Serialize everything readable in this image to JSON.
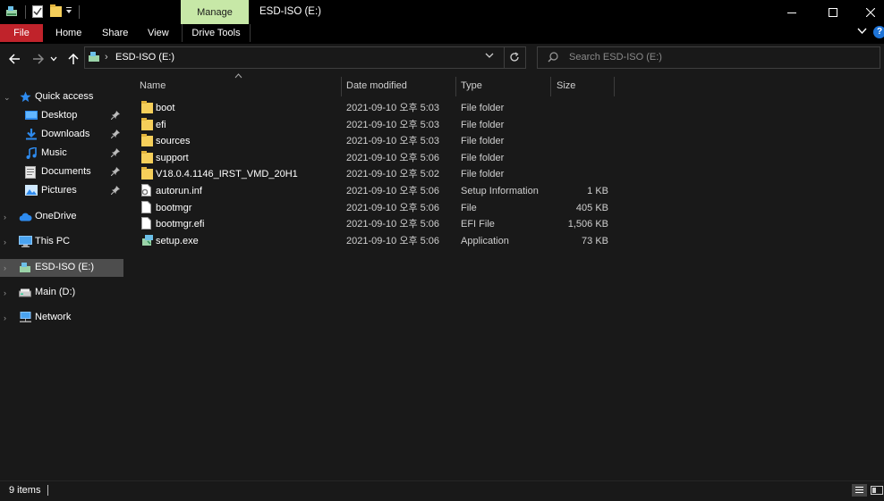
{
  "window": {
    "title": "ESD-ISO (E:)",
    "manage_tab": "Manage",
    "controls": {
      "minimize": "minimize-icon",
      "maximize": "maximize-icon",
      "close": "close-icon"
    }
  },
  "ribbon": {
    "tabs": [
      "File",
      "Home",
      "Share",
      "View",
      "Drive Tools"
    ],
    "file_color": "#c0232b",
    "manage_color": "#c7e8a7"
  },
  "address": {
    "path": "ESD-ISO (E:)",
    "search_placeholder": "Search ESD-ISO (E:)"
  },
  "nav": {
    "quick_access": "Quick access",
    "pinned": [
      "Desktop",
      "Downloads",
      "Music",
      "Documents",
      "Pictures"
    ],
    "onedrive": "OneDrive",
    "this_pc": "This PC",
    "esd_iso": "ESD-ISO (E:)",
    "main_d": "Main (D:)",
    "network": "Network"
  },
  "columns": {
    "name": "Name",
    "date": "Date modified",
    "type": "Type",
    "size": "Size"
  },
  "files": [
    {
      "name": "boot",
      "date": "2021-09-10 오후 5:03",
      "type": "File folder",
      "size": "",
      "icon": "folder-icon"
    },
    {
      "name": "efi",
      "date": "2021-09-10 오후 5:03",
      "type": "File folder",
      "size": "",
      "icon": "folder-icon"
    },
    {
      "name": "sources",
      "date": "2021-09-10 오후 5:03",
      "type": "File folder",
      "size": "",
      "icon": "folder-icon"
    },
    {
      "name": "support",
      "date": "2021-09-10 오후 5:06",
      "type": "File folder",
      "size": "",
      "icon": "folder-icon"
    },
    {
      "name": "V18.0.4.1146_IRST_VMD_20H1",
      "date": "2021-09-10 오후 5:02",
      "type": "File folder",
      "size": "",
      "icon": "folder-icon"
    },
    {
      "name": "autorun.inf",
      "date": "2021-09-10 오후 5:06",
      "type": "Setup Information",
      "size": "1 KB",
      "icon": "settings-file-icon"
    },
    {
      "name": "bootmgr",
      "date": "2021-09-10 오후 5:06",
      "type": "File",
      "size": "405 KB",
      "icon": "file-icon"
    },
    {
      "name": "bootmgr.efi",
      "date": "2021-09-10 오후 5:06",
      "type": "EFI File",
      "size": "1,506 KB",
      "icon": "file-icon"
    },
    {
      "name": "setup.exe",
      "date": "2021-09-10 오후 5:06",
      "type": "Application",
      "size": "73 KB",
      "icon": "setup-app-icon"
    }
  ],
  "status": {
    "count": "9 items"
  }
}
